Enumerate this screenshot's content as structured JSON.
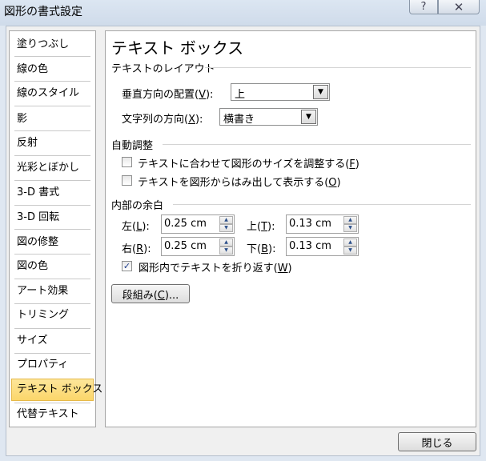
{
  "window": {
    "title": "図形の書式設定",
    "help_icon": "?",
    "close_icon": "✕"
  },
  "sidebar": {
    "items": [
      {
        "label": "塗りつぶし"
      },
      {
        "label": "線の色"
      },
      {
        "label": "線のスタイル"
      },
      {
        "label": "影"
      },
      {
        "label": "反射"
      },
      {
        "label": "光彩とぼかし"
      },
      {
        "label": "3-D 書式"
      },
      {
        "label": "3-D 回転"
      },
      {
        "label": "図の修整"
      },
      {
        "label": "図の色"
      },
      {
        "label": "アート効果"
      },
      {
        "label": "トリミング"
      },
      {
        "label": "サイズ"
      },
      {
        "label": "プロパティ"
      },
      {
        "label": "テキスト ボックス",
        "selected": true
      },
      {
        "label": "代替テキスト"
      }
    ]
  },
  "panel": {
    "heading": "テキスト ボックス",
    "layout_section": "テキストのレイアウト",
    "vertical_align": {
      "label": "垂直方向の配置(",
      "key": "V",
      "label_end": "):",
      "value": "上"
    },
    "text_direction": {
      "label": "文字列の方向(",
      "key": "X",
      "label_end": "):",
      "value": "横書き"
    },
    "autofit_section": "自動調整",
    "resize_shape": {
      "label": "テキストに合わせて図形のサイズを調整する(",
      "key": "F",
      "label_end": ")",
      "checked": false
    },
    "allow_overflow": {
      "label": "テキストを図形からはみ出して表示する(",
      "key": "O",
      "label_end": ")",
      "checked": false
    },
    "margin_section": "内部の余白",
    "margin_left": {
      "label": "左(",
      "key": "L",
      "label_end": "):",
      "value": "0.25 cm"
    },
    "margin_top": {
      "label": "上(",
      "key": "T",
      "label_end": "):",
      "value": "0.13 cm"
    },
    "margin_right": {
      "label": "右(",
      "key": "R",
      "label_end": "):",
      "value": "0.25 cm"
    },
    "margin_bottom": {
      "label": "下(",
      "key": "B",
      "label_end": "):",
      "value": "0.13 cm"
    },
    "wrap_text": {
      "label": "図形内でテキストを折り返す(",
      "key": "W",
      "label_end": ")",
      "checked": true
    },
    "columns_button": {
      "label": "段組み(",
      "key": "C",
      "label_end": ")..."
    }
  },
  "footer": {
    "close_button": "閉じる"
  }
}
